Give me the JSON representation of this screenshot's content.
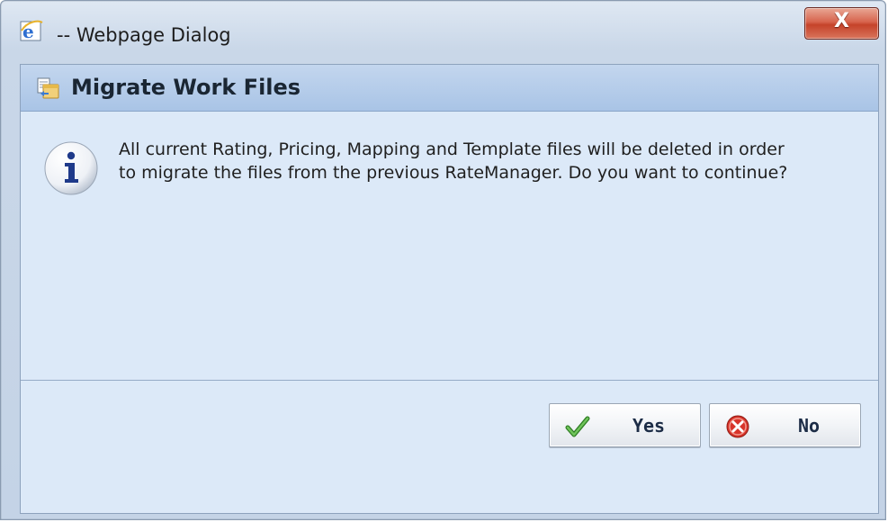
{
  "window": {
    "title": "-- Webpage Dialog",
    "close_glyph": "X",
    "icon": "ie-icon"
  },
  "dialog": {
    "header_title": "Migrate Work Files",
    "header_icon": "migrate-files-icon",
    "message_icon": "info-icon",
    "message": "All current Rating, Pricing, Mapping and Template files will be deleted in order to migrate the files from the previous RateManager. Do you want to continue?"
  },
  "buttons": {
    "yes_label": "Yes",
    "yes_icon": "checkmark-icon",
    "no_label": "No",
    "no_icon": "cancel-icon"
  },
  "colors": {
    "header_bg": "#b3cbea",
    "body_bg": "#dce9f8",
    "close_red": "#d1553c",
    "info_blue": "#1f3a8a",
    "check_green": "#3c9a2e",
    "cancel_red": "#d8342a"
  }
}
